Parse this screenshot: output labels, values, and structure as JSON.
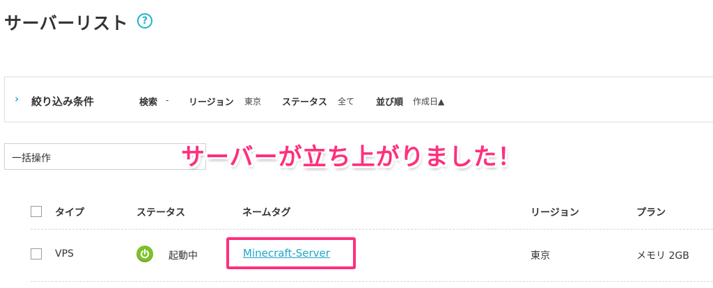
{
  "page": {
    "title": "サーバーリスト",
    "help_icon": "?"
  },
  "filter": {
    "title": "絞り込み条件",
    "chevron": "›",
    "fields": [
      {
        "label": "検索",
        "value": "-"
      },
      {
        "label": "リージョン",
        "value": "東京"
      },
      {
        "label": "ステータス",
        "value": "全て"
      },
      {
        "label": "並び順",
        "value": "作成日▲"
      }
    ]
  },
  "bulk": {
    "label": "一括操作"
  },
  "overlay": {
    "text": "サーバーが立ち上がりました！",
    "color": "#ff2f7d"
  },
  "table": {
    "headers": [
      "タイプ",
      "ステータス",
      "ネームタグ",
      "リージョン",
      "プラン"
    ],
    "rows": [
      {
        "type": "VPS",
        "status": "起動中",
        "name_tag": "Minecraft-Server",
        "region": "東京",
        "plan": "メモリ 2GB"
      }
    ]
  },
  "colors": {
    "accent": "#1fb3c9",
    "status_running": "#7cc128",
    "highlight": "#ff2f7d"
  },
  "icons": {
    "help": "help-icon",
    "expand": "chevron-right-icon",
    "status": "power-icon"
  }
}
